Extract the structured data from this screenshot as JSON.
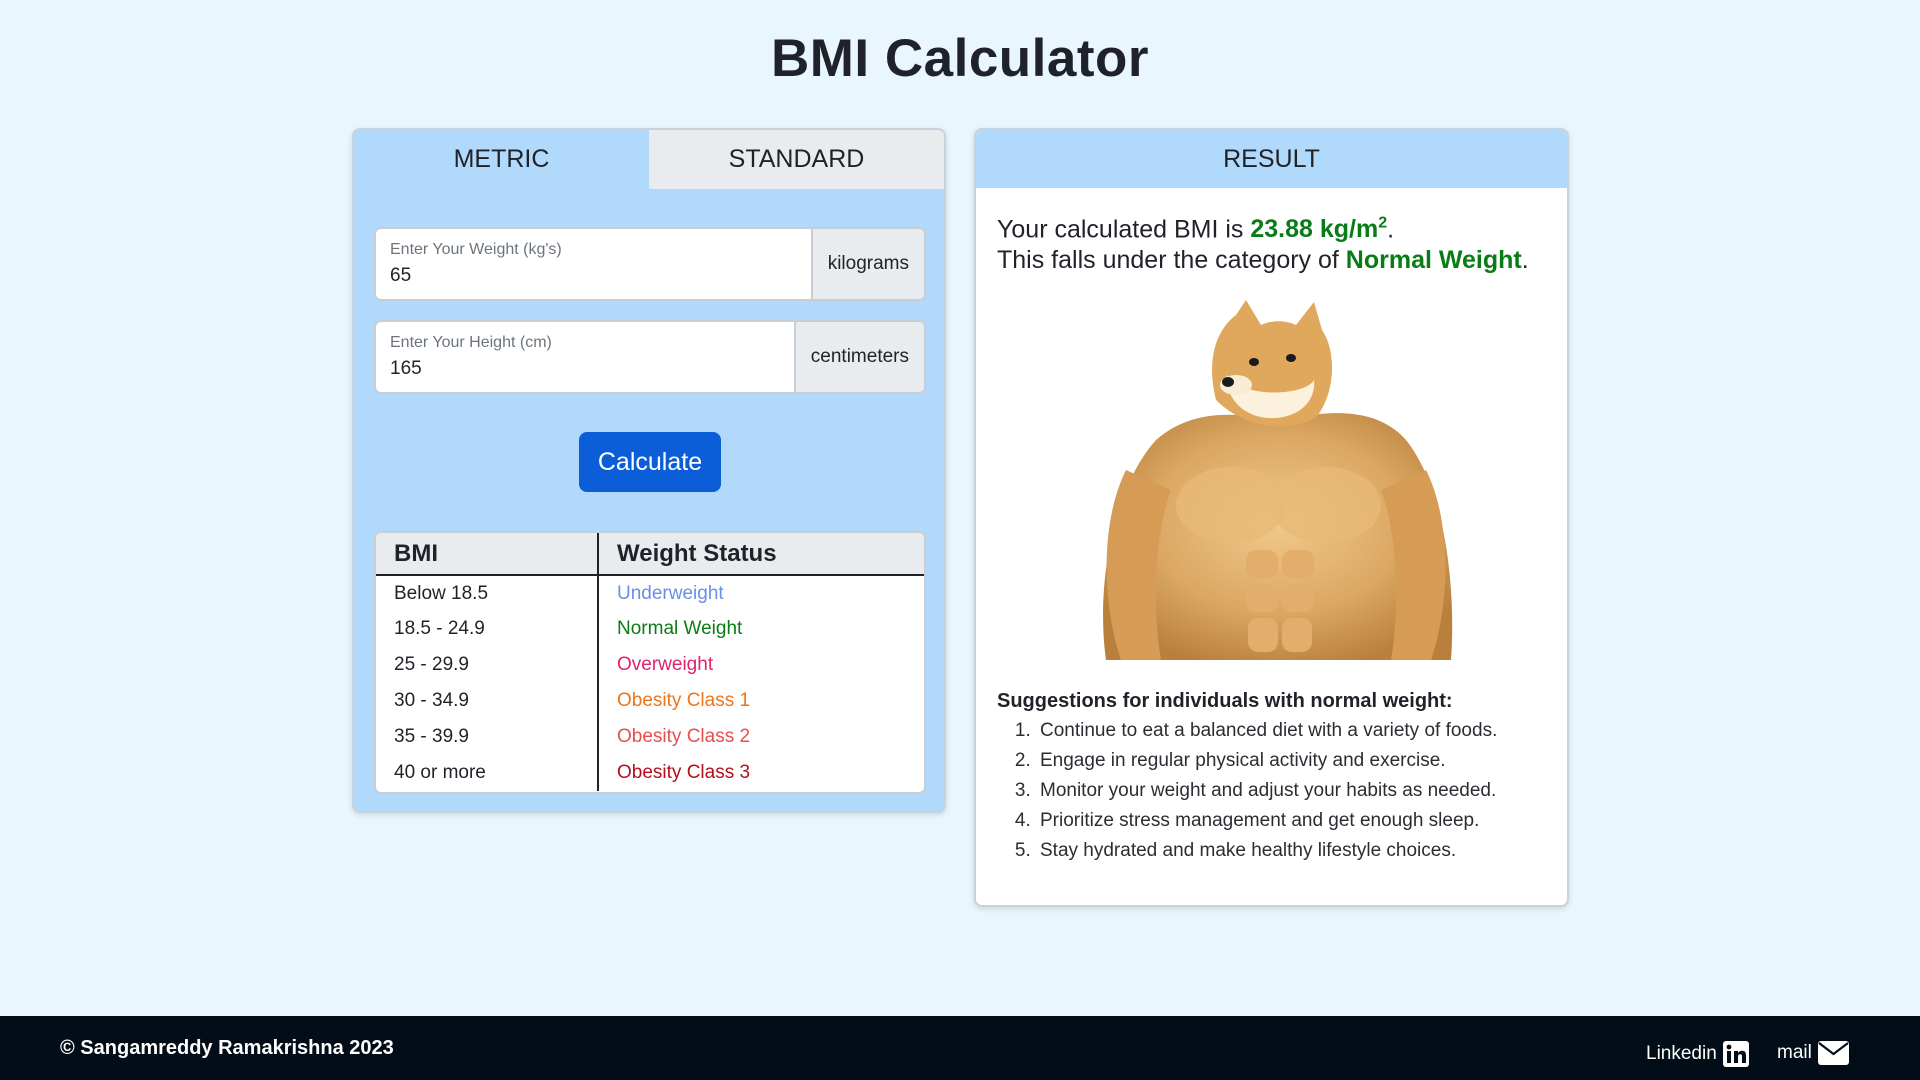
{
  "page": {
    "title": "BMI Calculator"
  },
  "tabs": {
    "metric": "METRIC",
    "standard": "STANDARD"
  },
  "form": {
    "weight": {
      "label": "Enter Your Weight (kg's)",
      "value": "65",
      "unit": "kilograms"
    },
    "height": {
      "label": "Enter Your Height (cm)",
      "value": "165",
      "unit": "centimeters"
    },
    "calculate": "Calculate"
  },
  "table": {
    "headers": [
      "BMI",
      "Weight Status"
    ],
    "rows": [
      {
        "bmi": "Below 18.5",
        "status": "Underweight",
        "color": "#6a8fe6"
      },
      {
        "bmi": "18.5 - 24.9",
        "status": "Normal Weight",
        "color": "#0a7c17"
      },
      {
        "bmi": "25 - 29.9",
        "status": "Overweight",
        "color": "#e0226b"
      },
      {
        "bmi": "30 - 34.9",
        "status": "Obesity Class 1",
        "color": "#f07418"
      },
      {
        "bmi": "35 - 39.9",
        "status": "Obesity Class 2",
        "color": "#e84e4e"
      },
      {
        "bmi": "40 or more",
        "status": "Obesity Class 3",
        "color": "#b3101c"
      }
    ]
  },
  "result": {
    "header": "RESULT",
    "line1_prefix": "Your calculated BMI is ",
    "bmi_value": "23.88 kg/m",
    "bmi_exponent": "2",
    "line1_suffix": ".",
    "line2_prefix": "This falls under the category of ",
    "category": "Normal Weight",
    "line2_suffix": ".",
    "suggestions_title": "Suggestions for individuals with normal weight:",
    "suggestions": [
      "Continue to eat a balanced diet with a variety of foods.",
      "Engage in regular physical activity and exercise.",
      "Monitor your weight and adjust your habits as needed.",
      "Prioritize stress management and get enough sleep.",
      "Stay hydrated and make healthy lifestyle choices."
    ]
  },
  "footer": {
    "copyright": "© Sangamreddy Ramakrishna 2023",
    "linkedin": "Linkedin",
    "mail": "mail",
    "linkedin_icon": "linkedin-icon",
    "mail_icon": "envelope-icon"
  }
}
